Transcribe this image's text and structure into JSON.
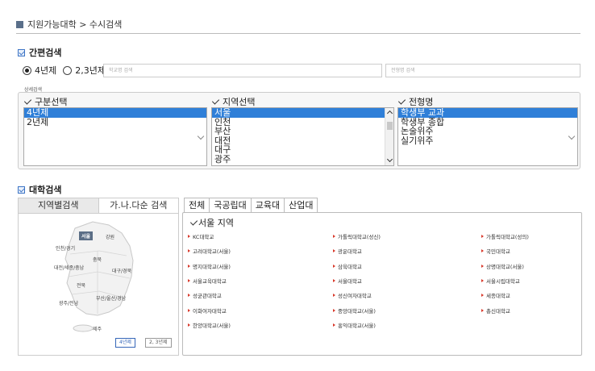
{
  "breadcrumb": {
    "text": "지원가능대학 > 수시검색"
  },
  "simple_search": {
    "title": "간편검색",
    "radios": [
      {
        "label": "4년제",
        "checked": true
      },
      {
        "label": "2,3년제",
        "checked": false
      }
    ],
    "school_placeholder": "학교명 검색",
    "type_placeholder": "전형명 검색",
    "detail_label": "상세검색"
  },
  "filters": {
    "division": {
      "title": "구분선택",
      "options": [
        {
          "label": "4년제",
          "selected": true
        },
        {
          "label": "2년제",
          "selected": false
        }
      ]
    },
    "region": {
      "title": "지역선택",
      "options": [
        {
          "label": "서울",
          "selected": true
        },
        {
          "label": "인천",
          "selected": false
        },
        {
          "label": "부산",
          "selected": false
        },
        {
          "label": "대전",
          "selected": false
        },
        {
          "label": "대구",
          "selected": false
        },
        {
          "label": "광주",
          "selected": false
        }
      ]
    },
    "admission": {
      "title": "전형명",
      "options": [
        {
          "label": "학생부 교과",
          "selected": true
        },
        {
          "label": "학생부 종합",
          "selected": false
        },
        {
          "label": "논술위주",
          "selected": false
        },
        {
          "label": "실기위주",
          "selected": false
        }
      ]
    }
  },
  "university_search": {
    "title": "대학검색",
    "left_tabs": [
      "지역별검색",
      "가.나.다순 검색"
    ],
    "map": {
      "labels": [
        "서울",
        "강원",
        "인천/경기",
        "충북",
        "대전/세종/충남",
        "대구/경북",
        "전북",
        "광주/전남",
        "부산/울산/경남",
        "제주"
      ],
      "buttons": [
        "4년제",
        "2, 3년제"
      ]
    },
    "right_tabs": [
      "전체",
      "국공립대",
      "교육대",
      "산업대"
    ],
    "region_title": "서울 지역",
    "universities": [
      "KC대학교",
      "가톨릭대학교(성신)",
      "가톨릭대학교(성의)",
      "고려대학교(서울)",
      "광운대학교",
      "국민대학교",
      "명지대학교(서울)",
      "삼육대학교",
      "상명대학교(서울)",
      "서울교육대학교",
      "서울대학교",
      "서울시립대학교",
      "성균관대학교",
      "성신여자대학교",
      "세종대학교",
      "이화여자대학교",
      "중앙대학교(서울)",
      "총신대학교",
      "한양대학교(서울)",
      "홍익대학교(서울)"
    ]
  },
  "colors": {
    "accent": "#2f7fd8",
    "bullet": "#d83a2c",
    "panel_bg": "#f7f7f7"
  }
}
